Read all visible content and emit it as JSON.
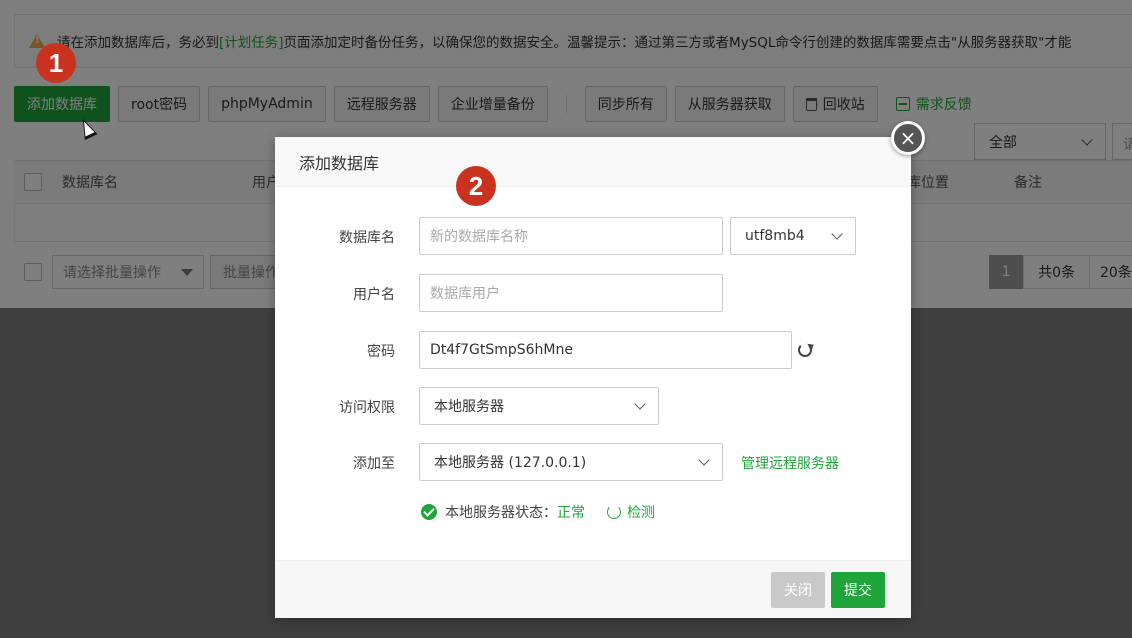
{
  "notice": {
    "text_before": "请在添加数据库后，务必到",
    "link": "[计划任务]",
    "text_after": "页面添加定时备份任务，以确保您的数据安全。温馨提示：通过第三方或者MySQL命令行创建的数据库需要点击\"从服务器获取\"才能"
  },
  "toolbar": {
    "add_db": "添加数据库",
    "root_password": "root密码",
    "phpmyadmin": "phpMyAdmin",
    "remote_server": "远程服务器",
    "incremental_backup": "企业增量备份",
    "sync_all": "同步所有",
    "fetch_from_server": "从服务器获取",
    "recycle_bin": "回收站",
    "feedback": "需求反馈"
  },
  "filter": {
    "selected": "全部",
    "search_stub": "请"
  },
  "table": {
    "headers": {
      "name": "数据库名",
      "user": "用户",
      "location": "库位置",
      "remark": "备注"
    }
  },
  "bottom": {
    "batch_placeholder": "请选择批量操作",
    "batch_button": "批量操作",
    "page": "1",
    "total": "共0条",
    "page_size": "20条"
  },
  "markers": {
    "one": "1",
    "two": "2"
  },
  "modal": {
    "title": "添加数据库",
    "close": "×",
    "fields": {
      "db_name_label": "数据库名",
      "db_name_placeholder": "新的数据库名称",
      "charset": "utf8mb4",
      "username_label": "用户名",
      "username_placeholder": "数据库用户",
      "password_label": "密码",
      "password_value": "Dt4f7GtSmpS6hMne",
      "access_label": "访问权限",
      "access_value": "本地服务器",
      "add_to_label": "添加至",
      "add_to_value": "本地服务器 (127.0.0.1)",
      "manage_remote": "管理远程服务器"
    },
    "status": {
      "label": "本地服务器状态：",
      "value": "正常",
      "detect": "检测"
    },
    "footer": {
      "cancel": "关闭",
      "submit": "提交"
    }
  },
  "colors": {
    "accent": "#20a53a",
    "marker": "#c8321e",
    "warning": "#f0ad4e"
  }
}
